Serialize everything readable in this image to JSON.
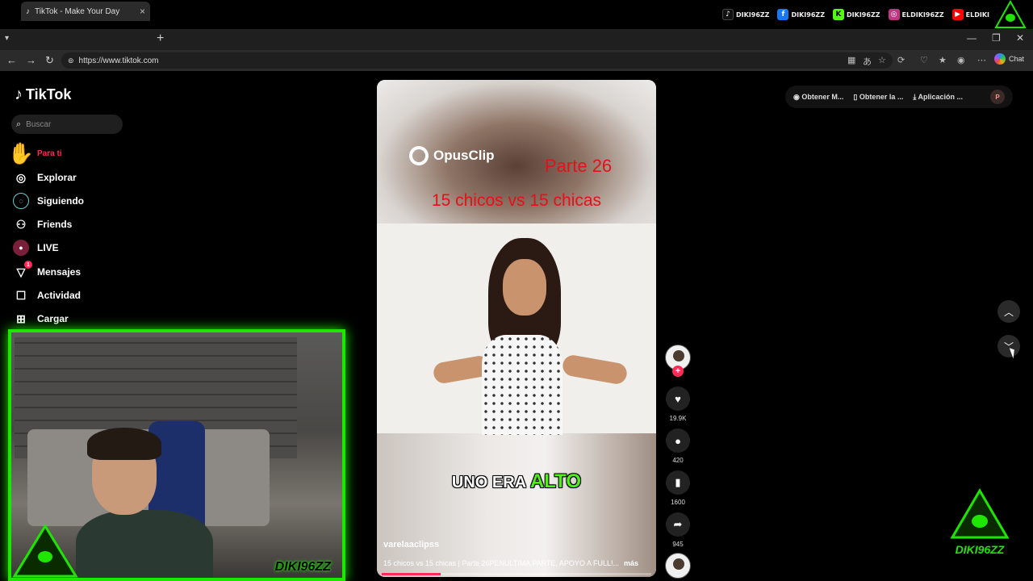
{
  "overlay": {
    "socials": [
      {
        "icon": "tiktok-icon",
        "handle": "DIKI96ZZ",
        "color": "#ffffff"
      },
      {
        "icon": "facebook-icon",
        "handle": "DIKI96ZZ",
        "color": "#1877f2"
      },
      {
        "icon": "kick-icon",
        "handle": "DIKI96ZZ",
        "color": "#53fc18"
      },
      {
        "icon": "instagram-icon",
        "handle": "ELDIKI96ZZ",
        "color": "#c13584"
      },
      {
        "icon": "youtube-icon",
        "handle": "ELDIKI",
        "color": "#ff0000"
      }
    ],
    "cam_name": "DIKI96ZZ",
    "brand_badge": "DIKI96ZZ",
    "accent_color": "#1ee600"
  },
  "browser": {
    "tab_title": "TikTok - Make Your Day",
    "url": "https://www.tiktok.com",
    "chat_label": "Chat"
  },
  "tiktok": {
    "logo": "TikTok",
    "search_placeholder": "Buscar",
    "nav": [
      {
        "label": "Para ti",
        "icon": "home-icon",
        "active": true
      },
      {
        "label": "Explorar",
        "icon": "compass-icon"
      },
      {
        "label": "Siguiendo",
        "icon": "following-icon"
      },
      {
        "label": "Friends",
        "icon": "friends-icon"
      },
      {
        "label": "LIVE",
        "icon": "live-icon"
      },
      {
        "label": "Mensajes",
        "icon": "messages-icon",
        "badge": "1"
      },
      {
        "label": "Actividad",
        "icon": "activity-icon"
      },
      {
        "label": "Cargar",
        "icon": "upload-icon"
      }
    ],
    "header": {
      "coins": "Obtener M...",
      "app": "Obtener la ...",
      "desktop_app": "Aplicación ...",
      "avatar_letter": "P"
    },
    "video": {
      "watermark": "OpusClip",
      "part": "Parte 26",
      "headline": "15 chicos vs 15 chicas",
      "caption_start": "UNO ERA",
      "caption_highlight": "ALTO",
      "username": "varelaaclipss",
      "description": "15 chicos vs 15 chicas | Parte 26PENULTIMA PARTE, APOYO A FULL!...",
      "more": "más",
      "progress": 0.22
    },
    "actions": {
      "likes": "19.9K",
      "comments": "420",
      "saves": "1600",
      "shares": "945"
    }
  }
}
